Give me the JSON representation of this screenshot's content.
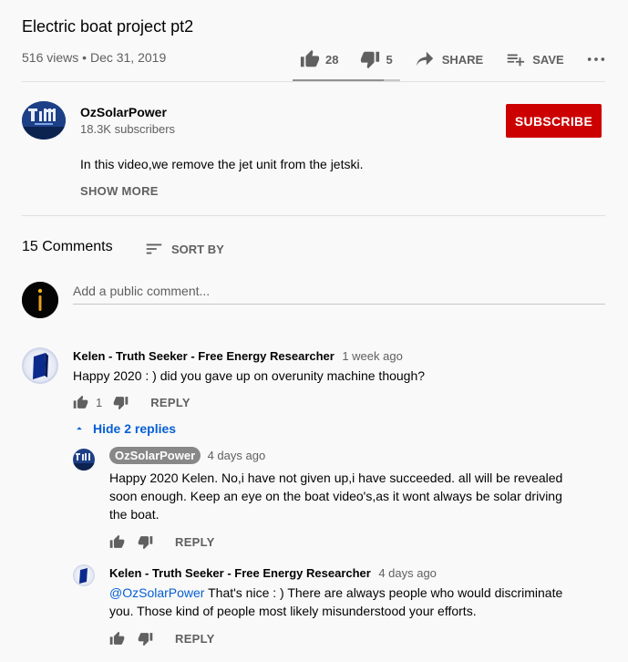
{
  "video": {
    "title": "Electric boat project pt2",
    "views": "516 views",
    "date": "Dec 31, 2019",
    "likes": "28",
    "dislikes": "5",
    "share_label": "SHARE",
    "save_label": "SAVE",
    "like_ratio": 0.85
  },
  "channel": {
    "name": "OzSolarPower",
    "subscribers": "18.3K subscribers",
    "subscribe_label": "SUBSCRIBE",
    "description": "In this video,we remove the jet unit from the jetski.",
    "show_more_label": "SHOW MORE"
  },
  "comments_header": {
    "count": "15 Comments",
    "sort_label": "SORT BY",
    "placeholder": "Add a public comment..."
  },
  "comments": [
    {
      "author": "Kelen - Truth Seeker - Free Energy Researcher",
      "time": "1 week ago",
      "text": "Happy 2020 : ) did you gave up on overunity machine though?",
      "likes": "1",
      "reply_label": "REPLY",
      "hide_replies_label": "Hide 2 replies",
      "replies": [
        {
          "author": "OzSolarPower",
          "time": "4 days ago",
          "text": "Happy 2020 Kelen. No,i have not given up,i have succeeded. all will be revealed soon enough. Keep an eye on the boat video's,as it wont always be solar driving the boat.",
          "reply_label": "REPLY"
        },
        {
          "author": "Kelen - Truth Seeker - Free Energy Researcher",
          "time": "4 days ago",
          "mention": "@OzSolarPower",
          "text": "That's nice : ) There are always people who would discriminate you. Those kind of people most likely misunderstood your efforts.",
          "reply_label": "REPLY"
        }
      ]
    }
  ],
  "colors": {
    "subscribe": "#cc0000",
    "link": "#065fd4",
    "background": "#f9f9f9"
  },
  "icons": [
    "thumb-up-icon",
    "thumb-down-icon",
    "share-icon",
    "playlist-add-icon",
    "more-icon",
    "sort-icon",
    "chevron-up-icon"
  ]
}
